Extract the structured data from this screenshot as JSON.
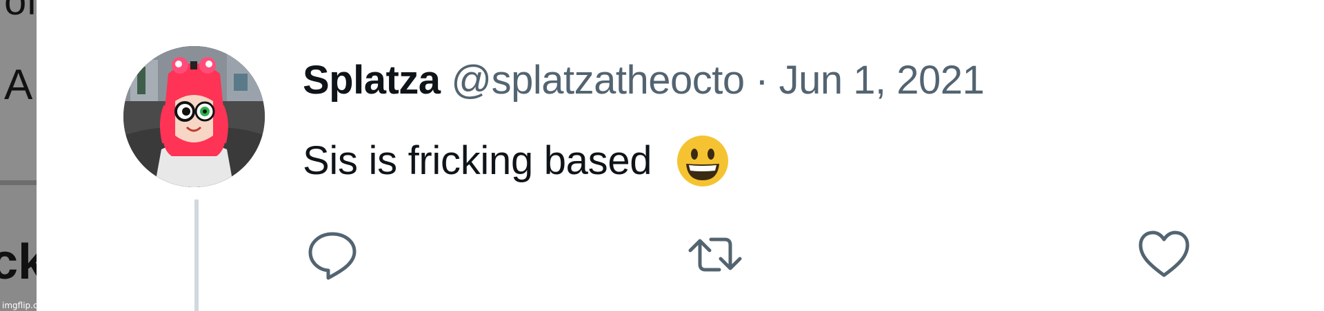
{
  "backdrop": {
    "fragment_top": "of",
    "fragment_middle": "A",
    "fragment_bottom": "ck",
    "watermark": "imgflip.com"
  },
  "tweet": {
    "author": {
      "display_name": "Splatza",
      "handle": "@splatzatheocto"
    },
    "separator": "·",
    "date": "Jun 1, 2021",
    "text": "Sis is fricking based",
    "emoji": "grinning-face-emoji"
  },
  "actions": [
    {
      "name": "reply",
      "icon": "reply-icon"
    },
    {
      "name": "retweet",
      "icon": "retweet-icon"
    },
    {
      "name": "like",
      "icon": "heart-icon"
    }
  ],
  "colors": {
    "text_primary": "#0f1419",
    "text_secondary": "#536471",
    "thread_line": "#cfd9de",
    "emoji_yellow": "#f5c332",
    "backdrop_gray": "#8d8d8d"
  }
}
